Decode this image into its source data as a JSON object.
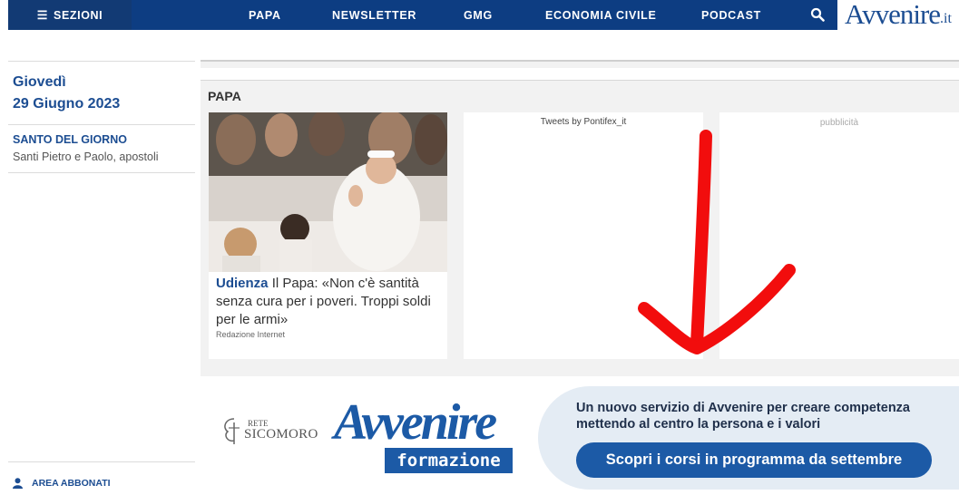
{
  "nav": {
    "menu_label": "SEZIONI",
    "items": [
      "PAPA",
      "NEWSLETTER",
      "GMG",
      "ECONOMIA CIVILE",
      "PODCAST"
    ],
    "logo_text": "Avvenire",
    "logo_tld": ".it"
  },
  "sidebar": {
    "day": "Giovedì",
    "date": "29 Giugno 2023",
    "santo_title": "SANTO DEL GIORNO",
    "santo_name": "Santi Pietro e Paolo, apostoli",
    "area_abbonati": "AREA ABBONATI"
  },
  "papa_section": {
    "title": "PAPA",
    "article": {
      "kicker": "Udienza",
      "headline": "Il Papa: «Non c'è santità senza cura per i poveri. Troppi soldi per le armi»",
      "author": "Redazione Internet"
    },
    "tweets_label": "Tweets by Pontifex_it",
    "ad_label": "pubblicità"
  },
  "banner": {
    "partner_line1": "RETE",
    "partner_line2": "SICOMORO",
    "logo_word": "Avvenire",
    "logo_sub": "formazione",
    "text": "Un nuovo servizio di Avvenire per creare competenza mettendo al centro la persona e i valori",
    "cta": "Scopri i corsi in programma da settembre"
  },
  "colors": {
    "nav_bg": "#0d3d82",
    "brand_blue": "#1c5aa6",
    "annotation_red": "#f20d0d"
  }
}
